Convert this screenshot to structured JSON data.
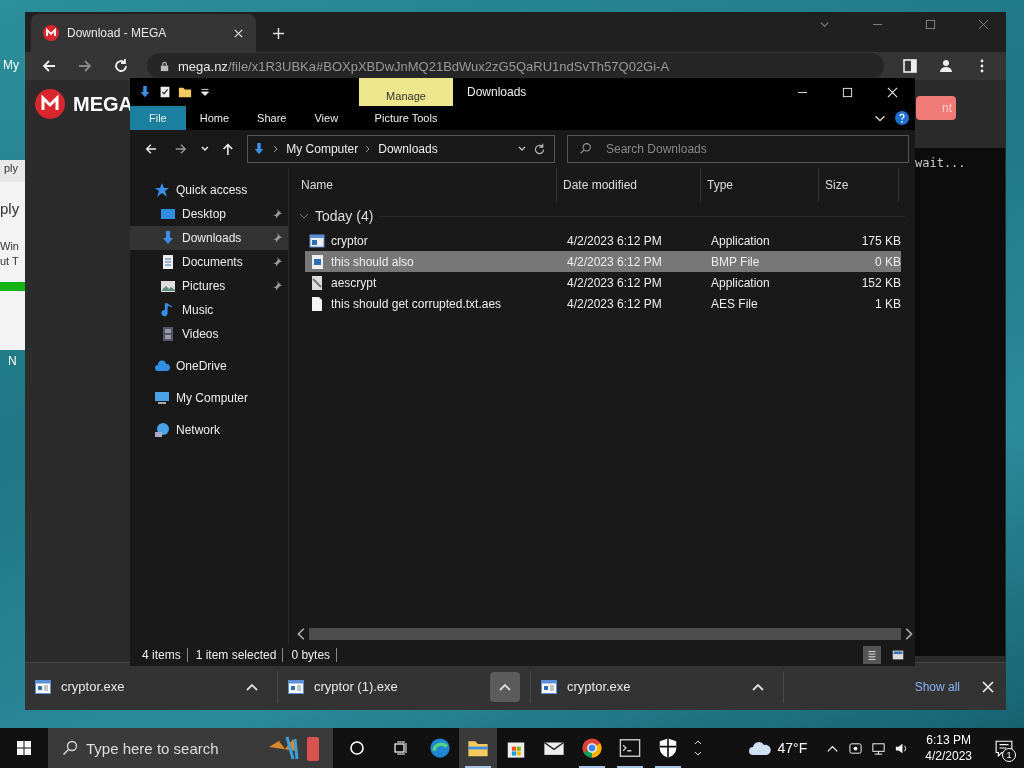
{
  "desktop": {
    "icon_labels": [
      "My",
      "N"
    ]
  },
  "background_window": {
    "texts": [
      "ply",
      "ply",
      "Win",
      "ut T"
    ]
  },
  "browser": {
    "tab_title": "Download - MEGA",
    "url": {
      "host": "mega.nz",
      "path": "/file/x1R3UBKa#BOXpXBDwJnMQ21BdWux2zG5QaRU1ndSvTh57Q02Gi-A"
    },
    "site_logo": "MEGA",
    "page_button": "nt",
    "downloads": [
      {
        "name": "cryptor.exe",
        "selected": false
      },
      {
        "name": "cryptor (1).exe",
        "selected": true
      },
      {
        "name": "cryptor.exe",
        "selected": false
      }
    ],
    "show_all": "Show all"
  },
  "terminal": {
    "text": "wait..."
  },
  "explorer": {
    "title": "Downloads",
    "context_tab": "Manage",
    "ribbon_tabs": [
      {
        "label": "File",
        "selected": true
      },
      {
        "label": "Home",
        "selected": false
      },
      {
        "label": "Share",
        "selected": false
      },
      {
        "label": "View",
        "selected": false
      }
    ],
    "context_ribbon_tab": "Picture Tools",
    "breadcrumbs": [
      "My Computer",
      "Downloads"
    ],
    "search": {
      "placeholder": "Search Downloads"
    },
    "nav": [
      {
        "label": "Quick access",
        "kind": "star",
        "selected": false,
        "pinned": false,
        "children": [
          {
            "label": "Desktop",
            "kind": "desktop",
            "selected": false,
            "pinned": true
          },
          {
            "label": "Downloads",
            "kind": "download",
            "selected": true,
            "pinned": true
          },
          {
            "label": "Documents",
            "kind": "document",
            "selected": false,
            "pinned": true
          },
          {
            "label": "Pictures",
            "kind": "pictures",
            "selected": false,
            "pinned": true
          },
          {
            "label": "Music",
            "kind": "music",
            "selected": false,
            "pinned": false
          },
          {
            "label": "Videos",
            "kind": "videos",
            "selected": false,
            "pinned": false
          }
        ]
      },
      {
        "label": "OneDrive",
        "kind": "cloud",
        "selected": false,
        "pinned": false
      },
      {
        "label": "My Computer",
        "kind": "computer",
        "selected": false,
        "pinned": false
      },
      {
        "label": "Network",
        "kind": "network",
        "selected": false,
        "pinned": false
      }
    ],
    "columns": [
      "Name",
      "Date modified",
      "Type",
      "Size"
    ],
    "group": {
      "label": "Today (4)",
      "expanded": true
    },
    "files": [
      {
        "name": "cryptor",
        "kind": "app",
        "date": "4/2/2023 6:12 PM",
        "type": "Application",
        "size": "175 KB",
        "selected": false
      },
      {
        "name": "this should also",
        "kind": "bitmap",
        "date": "4/2/2023 6:12 PM",
        "type": "BMP File",
        "size": "0 KB",
        "selected": true
      },
      {
        "name": "aescrypt",
        "kind": "installer",
        "date": "4/2/2023 6:12 PM",
        "type": "Application",
        "size": "152 KB",
        "selected": false
      },
      {
        "name": "this should get corrupted.txt.aes",
        "kind": "document",
        "date": "4/2/2023 6:12 PM",
        "type": "AES File",
        "size": "1 KB",
        "selected": false
      }
    ],
    "status": {
      "count": "4 items",
      "selection": "1 item selected",
      "bytes": "0 bytes"
    },
    "views": [
      {
        "kind": "details",
        "selected": true
      },
      {
        "kind": "tiles",
        "selected": false
      }
    ]
  },
  "taskbar": {
    "search_placeholder": "Type here to search",
    "apps": [
      {
        "kind": "edge",
        "open": false,
        "selected": false
      },
      {
        "kind": "explorer",
        "open": true,
        "selected": true
      },
      {
        "kind": "store",
        "open": false,
        "selected": false
      },
      {
        "kind": "mail",
        "open": false,
        "selected": false
      },
      {
        "kind": "chrome",
        "open": true,
        "selected": false
      },
      {
        "kind": "terminal",
        "open": true,
        "selected": false
      },
      {
        "kind": "shield",
        "open": true,
        "selected": false
      }
    ],
    "weather": "47°F",
    "time": "6:13 PM",
    "date": "4/2/2023",
    "notifications": "1"
  }
}
